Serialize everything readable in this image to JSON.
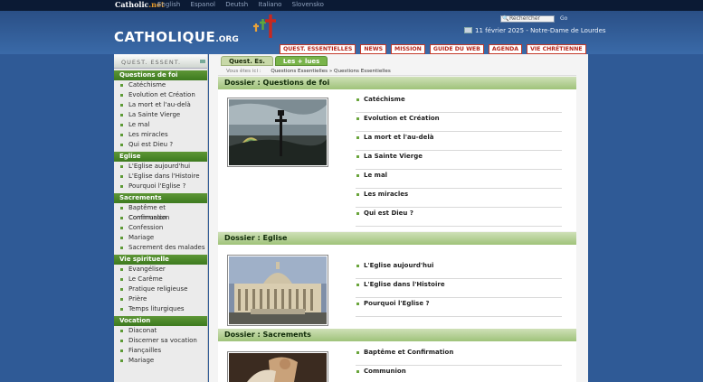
{
  "topbar": {
    "brand_main": "Catholic",
    "brand_net": ".net",
    "languages": [
      "English",
      "Espanol",
      "Deutsh",
      "Italiano",
      "Slovensko"
    ]
  },
  "header": {
    "search_placeholder": "Rechercher",
    "search_go": "Go",
    "date_line": "11 février 2025 - Notre-Dame de Lourdes",
    "logo_main": "CATHOLIQUE",
    "logo_org": ".ORG",
    "nav": [
      "QUEST. ESSENTIELLES",
      "NEWS",
      "MISSION",
      "GUIDE DU WEB",
      "AGENDA",
      "VIE CHRÉTIENNE"
    ]
  },
  "sidebar": {
    "head": "QUEST. ESSENT.",
    "sections": [
      {
        "title": "Questions de foi",
        "items": [
          "Catéchisme",
          "Evolution et Création",
          "La mort et l'au-delà",
          "La Sainte Vierge",
          "Le mal",
          "Les miracles",
          "Qui est Dieu ?"
        ]
      },
      {
        "title": "Eglise",
        "items": [
          "L'Eglise aujourd'hui",
          "L'Eglise dans l'Histoire",
          "Pourquoi l'Eglise ?"
        ]
      },
      {
        "title": "Sacrements",
        "items": [
          "Baptême et Confirmation",
          "Communion",
          "Confession",
          "Mariage",
          "Sacrement des malades"
        ]
      },
      {
        "title": "Vie spirituelle",
        "items": [
          "Evangéliser",
          "Le Carême",
          "Pratique religieuse",
          "Prière",
          "Temps liturgiques"
        ]
      },
      {
        "title": "Vocation",
        "items": [
          "Diaconat",
          "Discerner sa vocation",
          "Fiançailles",
          "Mariage"
        ]
      }
    ]
  },
  "main": {
    "tabs": [
      "Quest. Es.",
      "Les + lues"
    ],
    "crumbs_prefix": "Vous êtes ici :",
    "crumbs_path": "Questions Essentielles » Questions Essentielles",
    "dossiers": [
      {
        "title": "Dossier : Questions de foi",
        "links": [
          "Catéchisme",
          "Evolution et Création",
          "La mort et l'au-delà",
          "La Sainte Vierge",
          "Le mal",
          "Les miracles",
          "Qui est Dieu ?"
        ]
      },
      {
        "title": "Dossier : Eglise",
        "links": [
          "L'Eglise aujourd'hui",
          "L'Eglise dans l'Histoire",
          "Pourquoi l'Eglise ?"
        ]
      },
      {
        "title": "Dossier : Sacrements",
        "links": [
          "Baptême et Confirmation",
          "Communion"
        ]
      }
    ]
  },
  "colors": {
    "page_bg": "#2f5a96",
    "topbar_bg": "#0b1a34",
    "section_green": "#4a8a27",
    "nav_red": "#b8271b"
  }
}
